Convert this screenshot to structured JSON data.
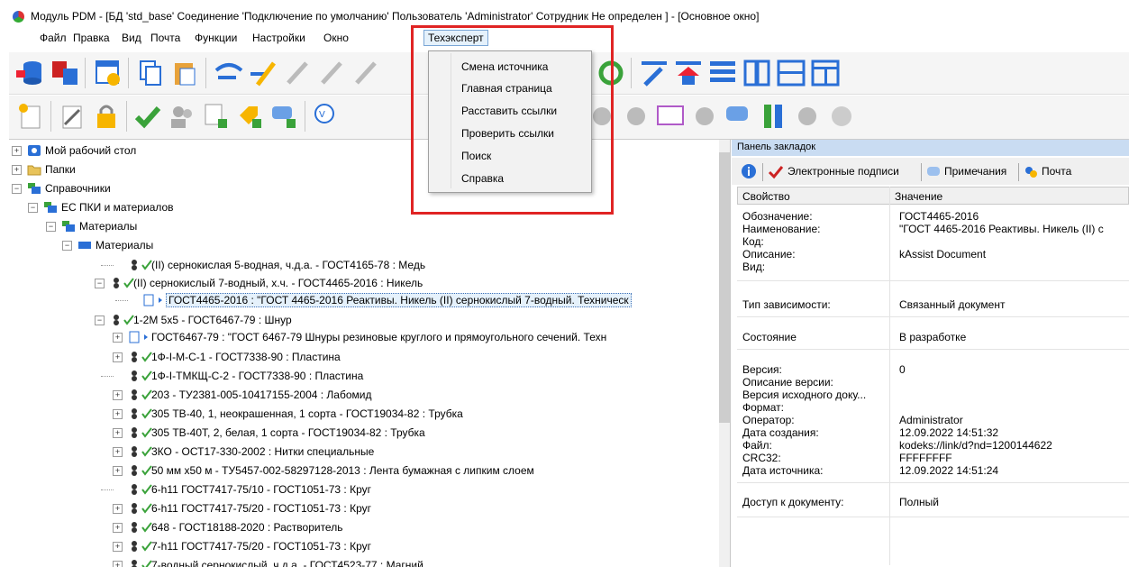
{
  "window": {
    "title": "Модуль PDM - [БД 'std_base' Соединение 'Подключение по умолчанию' Пользователь 'Administrator' Сотрудник Не определен ] - [Основное окно]"
  },
  "menubar": {
    "items": [
      "Файл",
      "Правка",
      "Вид",
      "Почта",
      "Функции",
      "Настройки",
      "Окно",
      "Техэксперт"
    ],
    "active": "Техэксперт"
  },
  "dropdown": {
    "items": [
      "Смена источника",
      "Главная страница",
      "Расставить ссылки",
      "Проверить ссылки",
      "Поиск",
      "Справка"
    ]
  },
  "tree": {
    "nodes": [
      {
        "label": "Мой рабочий стол",
        "icon": "desktop-icon"
      },
      {
        "label": "Папки",
        "icon": "folder-icon"
      },
      {
        "label": "Справочники",
        "icon": "catalog-icon"
      },
      {
        "label": "ЕС ПКИ и материалов",
        "icon": "catalog-icon"
      },
      {
        "label": "Материалы",
        "icon": "catalog-icon"
      },
      {
        "label": "Материалы",
        "icon": "list-icon"
      },
      {
        "label": "(II) сернокислая 5-водная, ч.д.а. - ГОСТ4165-78 : Медь",
        "icon": "material-icon"
      },
      {
        "label": "(II) сернокислый 7-водный, х.ч. - ГОСТ4465-2016 : Никель",
        "icon": "material-icon"
      },
      {
        "label": "ГОСТ4465-2016 : \"ГОСТ 4465-2016 Реактивы. Никель (II) сернокислый 7-водный. Техническ",
        "icon": "document-icon"
      },
      {
        "label": "1-2М 5х5 - ГОСТ6467-79 : Шнур",
        "icon": "material-icon"
      },
      {
        "label": "ГОСТ6467-79 : \"ГОСТ 6467-79 Шнуры резиновые круглого и прямоугольного сечений. Техн",
        "icon": "document-icon"
      },
      {
        "label": "1Ф-I-М-С-1 - ГОСТ7338-90 : Пластина",
        "icon": "material-icon"
      },
      {
        "label": "1Ф-I-ТМКЩ-С-2 - ГОСТ7338-90 : Пластина",
        "icon": "material-icon"
      },
      {
        "label": "203 - ТУ2381-005-10417155-2004 : Лабомид",
        "icon": "material-icon"
      },
      {
        "label": "305 ТВ-40, 1, неокрашенная, 1 сорта - ГОСТ19034-82 : Трубка",
        "icon": "material-icon"
      },
      {
        "label": "305 ТВ-40Т, 2, белая, 1 сорта - ГОСТ19034-82 : Трубка",
        "icon": "material-icon"
      },
      {
        "label": "3КО - ОСТ17-330-2002 : Нитки специальные",
        "icon": "material-icon"
      },
      {
        "label": "50 мм х50 м - ТУ5457-002-58297128-2013 : Лента бумажная с липким слоем",
        "icon": "material-icon"
      },
      {
        "label": "6-h11 ГОСТ7417-75/10 - ГОСТ1051-73 : Круг",
        "icon": "material-icon"
      },
      {
        "label": "6-h11 ГОСТ7417-75/20 - ГОСТ1051-73 : Круг",
        "icon": "material-icon"
      },
      {
        "label": "648 - ГОСТ18188-2020 : Растворитель",
        "icon": "material-icon"
      },
      {
        "label": "7-h11 ГОСТ7417-75/20 - ГОСТ1051-73 : Круг",
        "icon": "material-icon"
      },
      {
        "label": "7-водный сернокислый, ч.д.а. - ГОСТ4523-77 : Магний",
        "icon": "material-icon"
      }
    ]
  },
  "bookmarks": {
    "header": "Панель закладок",
    "tabs": [
      "Электронные подписи",
      "Примечания",
      "Почта"
    ],
    "columns": [
      "Свойство",
      "Значение"
    ],
    "rows": [
      {
        "k": "Обозначение:",
        "v": "ГОСТ4465-2016"
      },
      {
        "k": "Наименование:",
        "v": "\"ГОСТ 4465-2016 Реактивы. Никель (II) с"
      },
      {
        "k": "Код:",
        "v": ""
      },
      {
        "k": "Описание:",
        "v": "kAssist Document"
      },
      {
        "k": "Вид:",
        "v": ""
      },
      {
        "k": "Тип зависимости:",
        "v": "Связанный документ"
      },
      {
        "k": "Состояние",
        "v": "В разработке"
      },
      {
        "k": "Версия:",
        "v": "0"
      },
      {
        "k": "Описание версии:",
        "v": ""
      },
      {
        "k": "Версия исходного доку...",
        "v": ""
      },
      {
        "k": "Формат:",
        "v": ""
      },
      {
        "k": "Оператор:",
        "v": "Administrator"
      },
      {
        "k": "Дата создания:",
        "v": "12.09.2022  14:51:32"
      },
      {
        "k": "Файл:",
        "v": "kodeks://link/d?nd=1200144622"
      },
      {
        "k": "CRC32:",
        "v": "FFFFFFFF"
      },
      {
        "k": "Дата источника:",
        "v": "12.09.2022  14:51:24"
      },
      {
        "k": "Доступ к документу:",
        "v": "Полный"
      }
    ]
  },
  "colors": {
    "highlight": "#e02424",
    "selection": "#e5f1fb",
    "panel_header": "#c9dcf2"
  }
}
